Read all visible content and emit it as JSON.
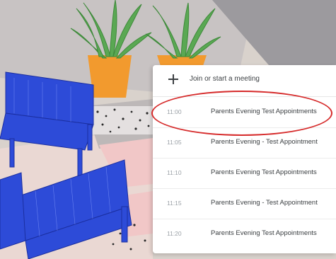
{
  "panel": {
    "join_label": "Join or start a meeting",
    "meetings": [
      {
        "time": "11:00",
        "title": "Parents Evening Test Appointments"
      },
      {
        "time": "11:05",
        "title": "Parents Evening - Test Appointment"
      },
      {
        "time": "11:10",
        "title": "Parents Evening Test Appointments"
      },
      {
        "time": "11:15",
        "title": "Parents Evening - Test Appointment"
      },
      {
        "time": "11:20",
        "title": "Parents Evening Test Appointments"
      }
    ]
  },
  "colors": {
    "highlight": "#d62b2b",
    "bench": "#2d4bd8",
    "pot": "#f29a2e",
    "plant": "#4f9a4a"
  }
}
